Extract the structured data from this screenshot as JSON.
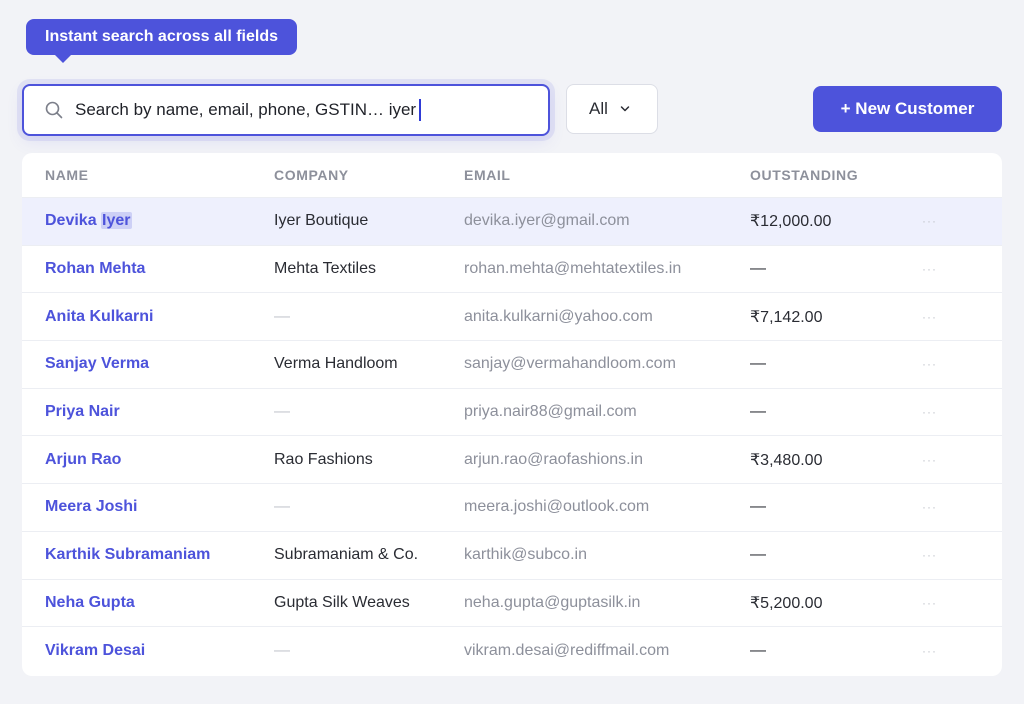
{
  "tooltip": {
    "text": "Instant search across all fields"
  },
  "search": {
    "value": "Search by name, email, phone, GSTIN… iyer"
  },
  "filter": {
    "selected": "All"
  },
  "actions": {
    "new_customer": "+ New Customer"
  },
  "table": {
    "headers": {
      "name": "NAME",
      "company": "COMPANY",
      "email": "EMAIL",
      "outstanding": "OUTSTANDING"
    },
    "rows": [
      {
        "first": "Devika",
        "match": "Iyer",
        "company": "Iyer Boutique",
        "email": "devika.iyer@gmail.com",
        "outstanding": "₹12,000.00",
        "menu": "···"
      },
      {
        "name": "Rohan Mehta",
        "company": "Mehta Textiles",
        "email": "rohan.mehta@mehtatextiles.in",
        "outstanding": "—",
        "menu": "···"
      },
      {
        "name": "Anita Kulkarni",
        "company": "—",
        "email": "anita.kulkarni@yahoo.com",
        "outstanding": "₹7,142.00",
        "menu": "···"
      },
      {
        "name": "Sanjay Verma",
        "company": "Verma Handloom",
        "email": "sanjay@vermahandloom.com",
        "outstanding": "—",
        "menu": "···"
      },
      {
        "name": "Priya Nair",
        "company": "—",
        "email": "priya.nair88@gmail.com",
        "outstanding": "—",
        "menu": "···"
      },
      {
        "name": "Arjun Rao",
        "company": "Rao Fashions",
        "email": "arjun.rao@raofashions.in",
        "outstanding": "₹3,480.00",
        "menu": "···"
      },
      {
        "name": "Meera Joshi",
        "company": "—",
        "email": "meera.joshi@outlook.com",
        "outstanding": "—",
        "menu": "···"
      },
      {
        "name": "Karthik Subramaniam",
        "company": "Subramaniam & Co.",
        "email": "karthik@subco.in",
        "outstanding": "—",
        "menu": "···"
      },
      {
        "name": "Neha Gupta",
        "company": "Gupta Silk Weaves",
        "email": "neha.gupta@guptasilk.in",
        "outstanding": "₹5,200.00",
        "menu": "···"
      },
      {
        "name": "Vikram Desai",
        "company": "—",
        "email": "vikram.desai@rediffmail.com",
        "outstanding": "—",
        "menu": "···"
      }
    ]
  }
}
